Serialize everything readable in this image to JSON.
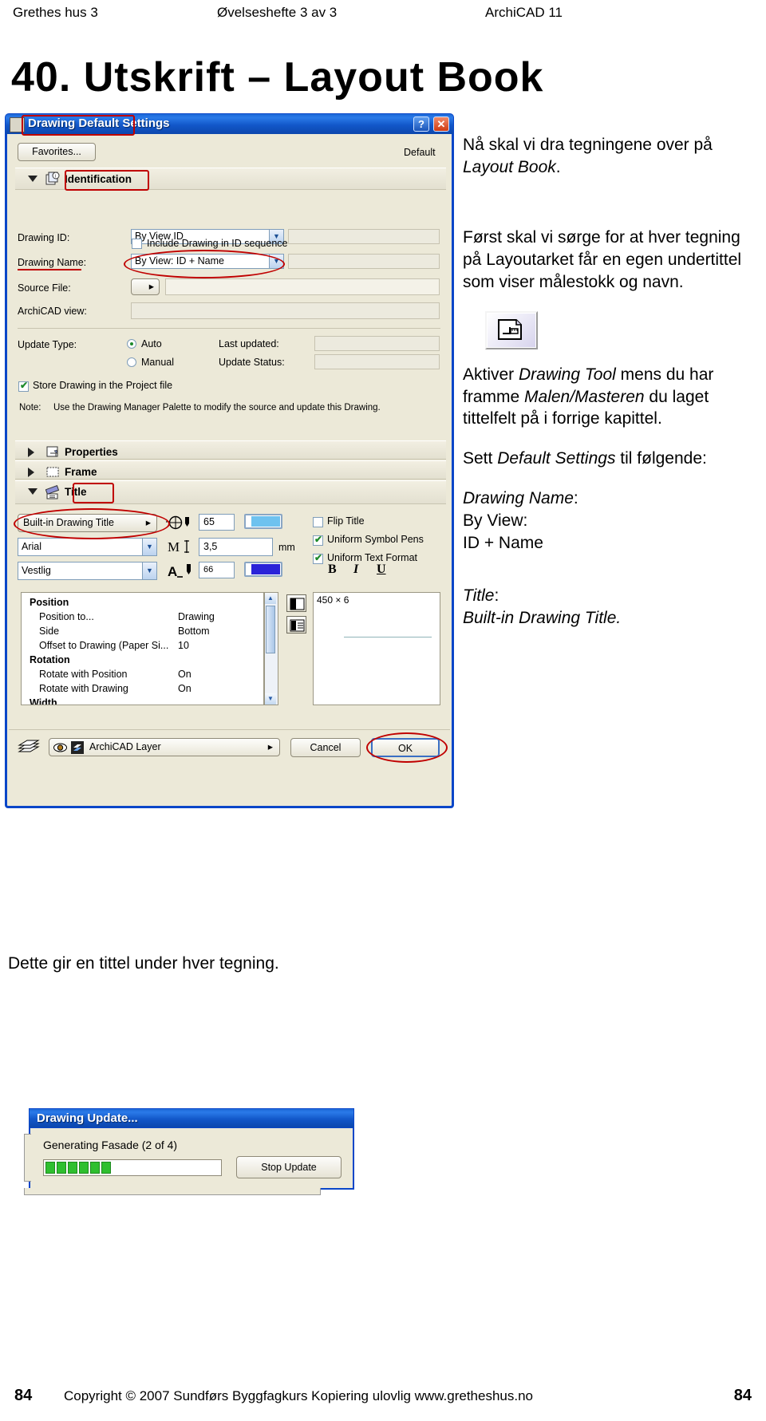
{
  "running_head": {
    "left": "Grethes hus 3",
    "center": "Øvelseshefte 3 av 3",
    "right": "ArchiCAD 11"
  },
  "chapter": {
    "title": "40. Utskrift – Layout Book"
  },
  "notes": {
    "p1_a": "Nå skal vi dra tegningene over på ",
    "p1_em": "Layout Book",
    "p1_b": ".",
    "p2": "Først skal vi sørge for at hver tegning på Layoutarket får en egen undertittel som viser målestokk og navn.",
    "p3_a": "Aktiver ",
    "p3_em1": "Drawing Tool",
    "p3_b": " mens du har framme ",
    "p3_em2": "Malen/Masteren",
    "p3_c": " du laget tittelfelt på i forrige kapittel.",
    "p4_a": "Sett ",
    "p4_em": "Default Settings",
    "p4_b": " til følgende:",
    "p5_l1_a": "Drawing Name",
    "p5_l1_b": ":",
    "p5_l2": "By View:",
    "p5_l3": "ID + Name",
    "p6_l1_a": "Title",
    "p6_l1_b": ":",
    "p6_l2": "Built-in Drawing Title.",
    "tool_icon": "drawing-tool-icon"
  },
  "dialog": {
    "title": "Drawing Default Settings",
    "window_icon": "archicad-drawing-icon",
    "help_button": "?",
    "close_button": "✕",
    "favorites_button": "Favorites...",
    "default_label": "Default",
    "sections": {
      "identification": {
        "label": "Identification",
        "icon": "identification-icon",
        "expanded": true
      },
      "properties": {
        "label": "Properties",
        "icon": "properties-icon",
        "expanded": false
      },
      "frame": {
        "label": "Frame",
        "icon": "frame-icon",
        "expanded": false
      },
      "title": {
        "label": "Title",
        "icon": "title-icon",
        "expanded": true
      }
    },
    "identification": {
      "drawing_id_label": "Drawing ID:",
      "drawing_id_value": "By View ID",
      "include_in_id_sequence_label": "Include Drawing in ID sequence",
      "include_in_id_sequence_checked": false,
      "drawing_name_label": "Drawing Name:",
      "drawing_name_value": "By View: ID + Name",
      "source_file_label": "Source File:",
      "source_file_value": "",
      "archicad_view_label": "ArchiCAD view:",
      "archicad_view_value": "",
      "update_type_label": "Update Type:",
      "update_auto_label": "Auto",
      "update_manual_label": "Manual",
      "update_selected": "Auto",
      "last_updated_label": "Last updated:",
      "last_updated_value": "",
      "update_status_label": "Update Status:",
      "update_status_value": "",
      "store_drawing_label": "Store Drawing in the Project file",
      "store_drawing_checked": true,
      "note_prefix": "Note:",
      "note_text": "Use the Drawing Manager Palette to modify the source and update this Drawing."
    },
    "title_settings": {
      "title_type_value": "Built-in Drawing Title",
      "font_value": "Arial",
      "style_value": "Vestlig",
      "symbol_pen_icon": "symbol-pen-icon",
      "symbol_pen_value": "65",
      "symbol_pen_color": "#6ec2ef",
      "text_size_icon": "text-size-icon",
      "text_size_value": "3,5",
      "text_size_unit": "mm",
      "text_pen_icon": "text-pen-icon",
      "text_pen_value": "66",
      "text_pen_color": "#2a23d8",
      "flip_title_label": "Flip Title",
      "flip_title_checked": false,
      "uniform_symbol_pens_label": "Uniform Symbol Pens",
      "uniform_symbol_pens_checked": true,
      "uniform_text_format_label": "Uniform Text Format",
      "uniform_text_format_checked": true,
      "bold_label": "B",
      "italic_label": "I",
      "underline_label": "U"
    },
    "parameter_list": [
      {
        "key": "Position",
        "value": "",
        "group": true
      },
      {
        "key": "Position to...",
        "value": "Drawing",
        "group": false
      },
      {
        "key": "Side",
        "value": "Bottom",
        "group": false
      },
      {
        "key": "Offset to Drawing (Paper Si...",
        "value": "10",
        "group": false
      },
      {
        "key": "Rotation",
        "value": "",
        "group": true
      },
      {
        "key": "Rotate with Position",
        "value": "On",
        "group": false
      },
      {
        "key": "Rotate with Drawing",
        "value": "On",
        "group": false
      },
      {
        "key": "Width",
        "value": "",
        "group": true
      }
    ],
    "preview": {
      "size_label": "450 × 6"
    },
    "footer": {
      "layers_icon": "layers-icon",
      "eye_icon": "eye-visible-icon",
      "layer_icon": "layer-icon",
      "layer_value": "ArchiCAD Layer",
      "cancel_button": "Cancel",
      "ok_button": "OK"
    }
  },
  "caption": "Dette gir en tittel under hver tegning.",
  "progress_dialog": {
    "title": "Drawing Update...",
    "message": "Generating Fasade (2 of 4)",
    "stop_button": "Stop Update",
    "blocks_filled": 6
  },
  "page_footer": {
    "page_left": "84",
    "page_right": "84",
    "copyright": "Copyright © 2007  Sundførs Byggfagkurs   Kopiering ulovlig  www.gretheshus.no"
  },
  "colors": {
    "title_bar_blue": "#0a46c8",
    "dialog_bg": "#ece9d8",
    "annotation_red": "#c00000",
    "progress_green": "#2fbf2f"
  }
}
